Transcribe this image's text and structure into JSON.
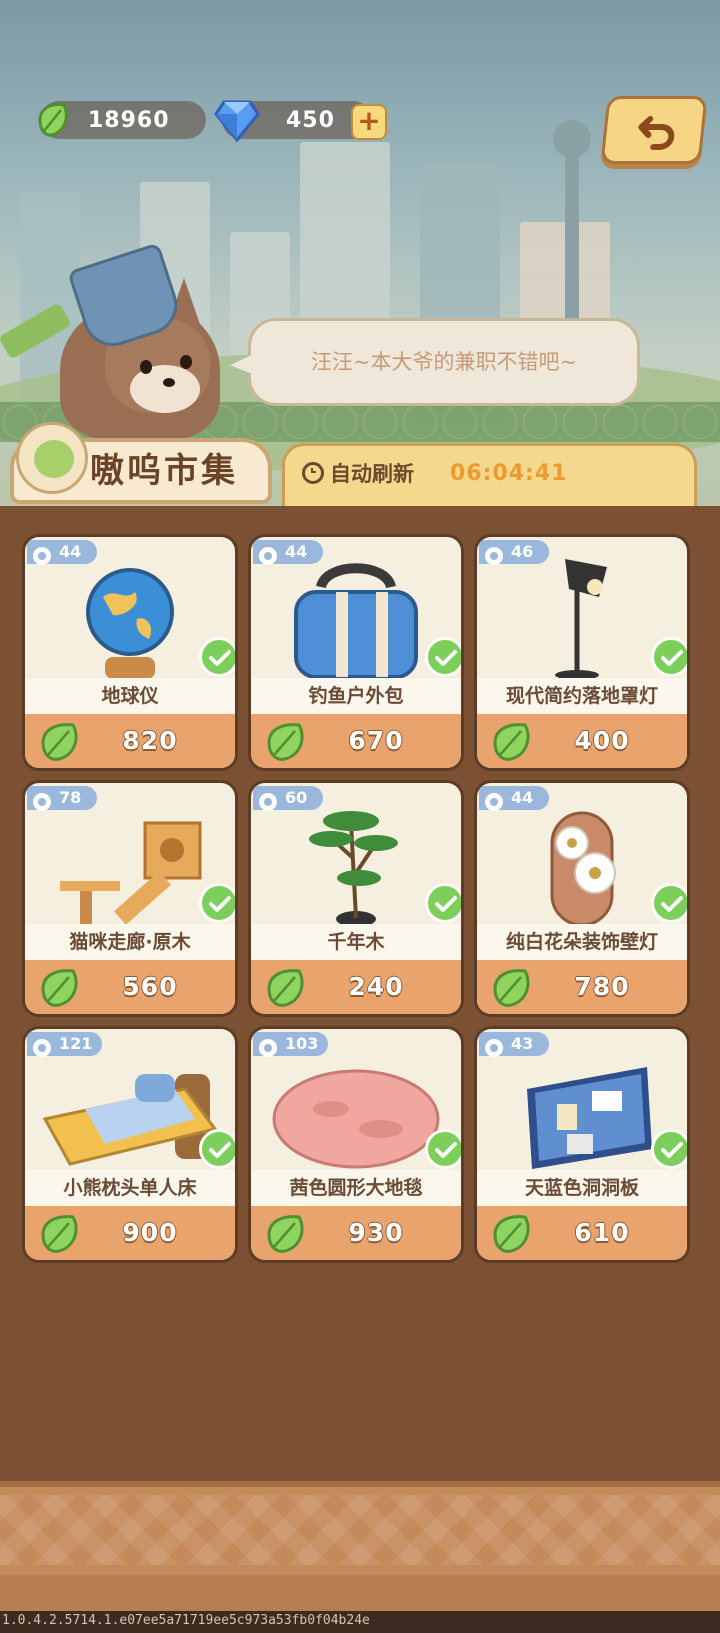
{
  "currency": {
    "leaf_amount": "18960",
    "gem_amount": "450",
    "add_symbol": "+"
  },
  "npc": {
    "speech": "汪汪~本大爷的兼职不错吧~"
  },
  "shop": {
    "title": "嗷呜市集",
    "refresh_label": "自动刷新",
    "refresh_time": "06:04:41"
  },
  "items": [
    {
      "name": "地球仪",
      "price": "820",
      "level": "44",
      "art": "globe-icon",
      "owned": true
    },
    {
      "name": "钓鱼户外包",
      "price": "670",
      "level": "44",
      "art": "bag-icon",
      "owned": true
    },
    {
      "name": "现代简约落地罩灯",
      "price": "400",
      "level": "46",
      "art": "floor-lamp-icon",
      "owned": true
    },
    {
      "name": "猫咪走廊·原木",
      "price": "560",
      "level": "78",
      "art": "cat-walkway-icon",
      "owned": true
    },
    {
      "name": "千年木",
      "price": "240",
      "level": "60",
      "art": "plant-icon",
      "owned": true
    },
    {
      "name": "纯白花朵装饰壁灯",
      "price": "780",
      "level": "44",
      "art": "flower-lamp-icon",
      "owned": true
    },
    {
      "name": "小熊枕头单人床",
      "price": "900",
      "level": "121",
      "art": "bed-icon",
      "owned": true
    },
    {
      "name": "茜色圆形大地毯",
      "price": "930",
      "level": "103",
      "art": "rug-icon",
      "owned": true
    },
    {
      "name": "天蓝色洞洞板",
      "price": "610",
      "level": "43",
      "art": "pegboard-icon",
      "owned": true
    }
  ],
  "version": "1.0.4.2.5714.1.e07ee5a71719ee5c973a53fb0f04b24e",
  "colors": {
    "leaf": "#7ccf5a",
    "price_band": "#e9a46e",
    "timer": "#ee9a32",
    "panel": "#7c5133"
  }
}
